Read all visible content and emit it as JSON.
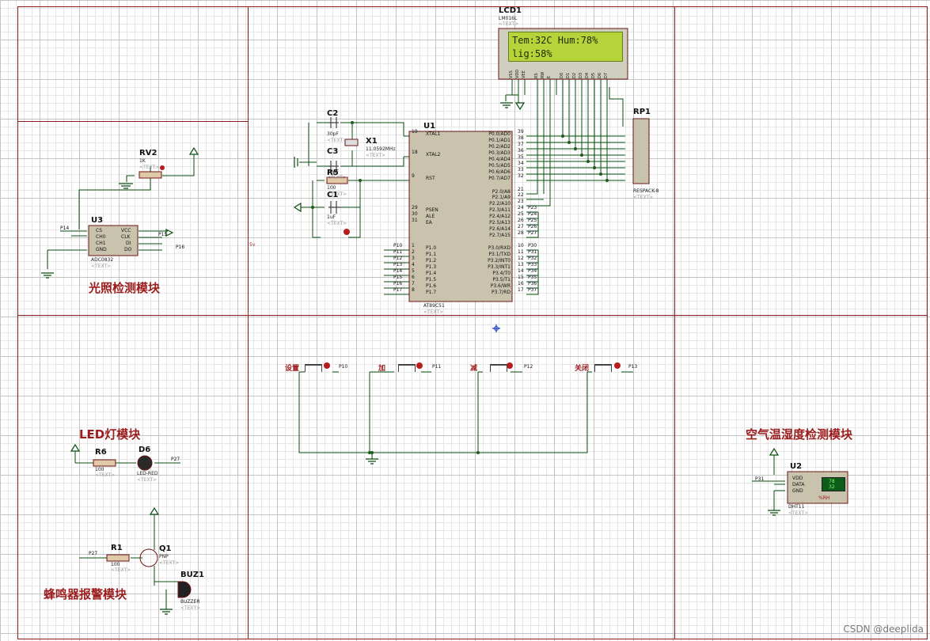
{
  "modules": {
    "light": "光照检测模块",
    "led": "LED灯模块",
    "buzzer": "蜂鸣器报警模块",
    "humidity": "空气温湿度检测模块"
  },
  "lcd": {
    "ref": "LCD1",
    "part": "LM016L",
    "text_tag": "<TEXT>",
    "line1": "Tem:32C  Hum:78%",
    "line2": "lig:58%",
    "pins": [
      "VSS",
      "VDD",
      "VEE",
      "RS",
      "RW",
      "E",
      "D0",
      "D1",
      "D2",
      "D3",
      "D4",
      "D5",
      "D6",
      "D7"
    ]
  },
  "mcu": {
    "ref": "U1",
    "part": "AT89C51",
    "text_tag": "<TEXT>",
    "left_pins": [
      {
        "num": "19",
        "name": "XTAL1"
      },
      {
        "num": "18",
        "name": "XTAL2"
      },
      {
        "num": "9",
        "name": "RST"
      },
      {
        "num": "29",
        "name": "PSEN"
      },
      {
        "num": "30",
        "name": "ALE"
      },
      {
        "num": "31",
        "name": "EA"
      },
      {
        "num": "1",
        "name": "P1.0",
        "net": "P10"
      },
      {
        "num": "2",
        "name": "P1.1",
        "net": "P11"
      },
      {
        "num": "3",
        "name": "P1.2",
        "net": "P12"
      },
      {
        "num": "4",
        "name": "P1.3",
        "net": "P13"
      },
      {
        "num": "5",
        "name": "P1.4",
        "net": "P14"
      },
      {
        "num": "6",
        "name": "P1.5",
        "net": "P15"
      },
      {
        "num": "7",
        "name": "P1.6",
        "net": "P16"
      },
      {
        "num": "8",
        "name": "P1.7",
        "net": "P17"
      }
    ],
    "right_pins": [
      {
        "num": "39",
        "name": "P0.0/AD0"
      },
      {
        "num": "38",
        "name": "P0.1/AD1"
      },
      {
        "num": "37",
        "name": "P0.2/AD2"
      },
      {
        "num": "36",
        "name": "P0.3/AD3"
      },
      {
        "num": "35",
        "name": "P0.4/AD4"
      },
      {
        "num": "34",
        "name": "P0.5/AD5"
      },
      {
        "num": "33",
        "name": "P0.6/AD6"
      },
      {
        "num": "32",
        "name": "P0.7/AD7"
      },
      {
        "num": "21",
        "name": "P2.0/A8"
      },
      {
        "num": "22",
        "name": "P2.1/A9"
      },
      {
        "num": "23",
        "name": "P2.2/A10"
      },
      {
        "num": "24",
        "name": "P2.3/A11",
        "net": "P23"
      },
      {
        "num": "25",
        "name": "P2.4/A12",
        "net": "P24"
      },
      {
        "num": "26",
        "name": "P2.5/A13",
        "net": "P25"
      },
      {
        "num": "27",
        "name": "P2.6/A14",
        "net": "P26"
      },
      {
        "num": "28",
        "name": "P2.7/A15",
        "net": "P27"
      },
      {
        "num": "10",
        "name": "P3.0/RXD",
        "net": "P30"
      },
      {
        "num": "11",
        "name": "P3.1/TXD",
        "net": "P31"
      },
      {
        "num": "12",
        "name": "P3.2/INT0",
        "net": "P32"
      },
      {
        "num": "13",
        "name": "P3.3/INT1",
        "net": "P33"
      },
      {
        "num": "14",
        "name": "P3.4/T0",
        "net": "P34"
      },
      {
        "num": "15",
        "name": "P3.5/T1",
        "net": "P35"
      },
      {
        "num": "16",
        "name": "P3.6/WR",
        "net": "P36"
      },
      {
        "num": "17",
        "name": "P3.7/RD",
        "net": "P37"
      }
    ]
  },
  "components": {
    "c2": {
      "ref": "C2",
      "val": "30pF",
      "tx": "<TEXT>"
    },
    "c3": {
      "ref": "C3",
      "val": "30pF",
      "tx": "<TEXT>"
    },
    "c1": {
      "ref": "C1",
      "val": "1uF",
      "tx": "<TEXT>"
    },
    "x1": {
      "ref": "X1",
      "val": "11.0592MHz",
      "tx": "<TEXT>"
    },
    "r5": {
      "ref": "R5",
      "val": "100",
      "tx": "<TEXT>"
    },
    "rp1": {
      "ref": "RP1",
      "val": "RESPACK-8",
      "tx": "<TEXT>"
    },
    "rv2": {
      "ref": "RV2",
      "val": "1K",
      "tx": "<TEXT>"
    },
    "u3": {
      "ref": "U3",
      "val": "ADC0832",
      "tx": "<TEXT>",
      "pins": [
        "CS",
        "CH0",
        "CH1",
        "GND",
        "VCC",
        "CLK",
        "DI",
        "DO"
      ]
    },
    "r6": {
      "ref": "R6",
      "val": "100",
      "tx": "<TEXT>"
    },
    "d6": {
      "ref": "D6",
      "val": "LED-RED",
      "tx": "<TEXT>"
    },
    "r1": {
      "ref": "R1",
      "val": "100",
      "tx": "<TEXT>"
    },
    "q1": {
      "ref": "Q1",
      "val": "PNP",
      "tx": "<TEXT>"
    },
    "buz1": {
      "ref": "BUZ1",
      "val": "BUZZER",
      "tx": "<TEXT>"
    },
    "u2": {
      "ref": "U2",
      "val": "DHT11",
      "tx": "<TEXT>",
      "pins": [
        "VDD",
        "DATA",
        "GND"
      ],
      "temp": "78",
      "hum": "32",
      "unit": "%RH"
    }
  },
  "nets": {
    "p14": "P14",
    "p15": "P15",
    "p16": "P16",
    "p27a": "P27",
    "p27b": "P27",
    "p31": "P31",
    "p10": "P10",
    "p11": "P11",
    "p12": "P12",
    "p13": "P13"
  },
  "buttons": [
    {
      "label": "设置",
      "net": "P10"
    },
    {
      "label": "加",
      "net": "P11"
    },
    {
      "label": "减",
      "net": "P12"
    },
    {
      "label": "关闭",
      "net": "P13"
    }
  ],
  "misc": {
    "left_marker": "5v"
  },
  "watermark": "CSDN @deeplida"
}
